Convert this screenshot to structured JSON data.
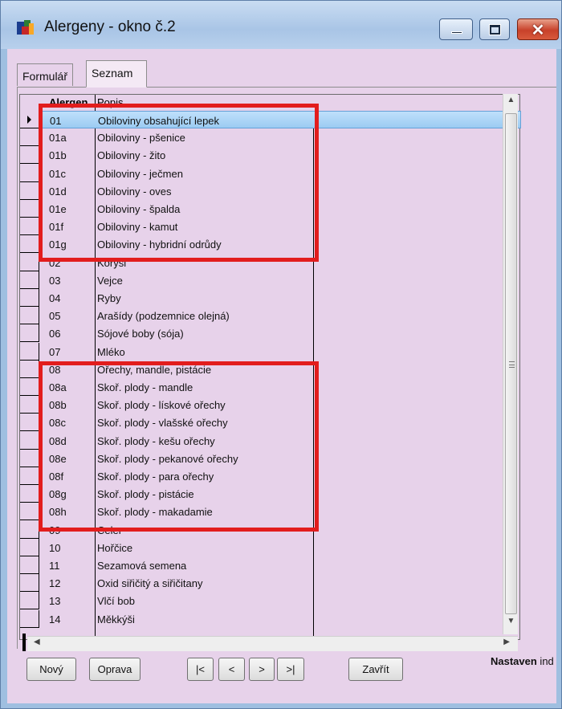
{
  "window": {
    "title": "Alergeny - okno č.2",
    "icon": "app-icon"
  },
  "tabs": [
    {
      "label": "Formulář",
      "active": false
    },
    {
      "label": "Seznam",
      "active": true
    }
  ],
  "grid": {
    "columns": [
      "Alergen",
      "Popis"
    ],
    "rows": [
      {
        "code": "01",
        "desc": "Obiloviny obsahující lepek",
        "selected": true
      },
      {
        "code": "01a",
        "desc": "Obiloviny - pšenice"
      },
      {
        "code": "01b",
        "desc": "Obiloviny - žito"
      },
      {
        "code": "01c",
        "desc": "Obiloviny - ječmen"
      },
      {
        "code": "01d",
        "desc": "Obiloviny - oves"
      },
      {
        "code": "01e",
        "desc": "Obiloviny - špalda"
      },
      {
        "code": "01f",
        "desc": "Obiloviny - kamut"
      },
      {
        "code": "01g",
        "desc": "Obiloviny - hybridní odrůdy"
      },
      {
        "code": "02",
        "desc": "Korýši"
      },
      {
        "code": "03",
        "desc": "Vejce"
      },
      {
        "code": "04",
        "desc": "Ryby"
      },
      {
        "code": "05",
        "desc": "Arašídy (podzemnice olejná)"
      },
      {
        "code": "06",
        "desc": "Sójové boby (sója)"
      },
      {
        "code": "07",
        "desc": "Mléko"
      },
      {
        "code": "08",
        "desc": "Ořechy, mandle, pistácie"
      },
      {
        "code": "08a",
        "desc": "Skoř. plody - mandle"
      },
      {
        "code": "08b",
        "desc": "Skoř. plody - lískové ořechy"
      },
      {
        "code": "08c",
        "desc": "Skoř. plody - vlašské ořechy"
      },
      {
        "code": "08d",
        "desc": "Skoř. plody - kešu ořechy"
      },
      {
        "code": "08e",
        "desc": "Skoř. plody - pekanové ořechy"
      },
      {
        "code": "08f",
        "desc": "Skoř. plody - para ořechy"
      },
      {
        "code": "08g",
        "desc": "Skoř. plody - pistácie"
      },
      {
        "code": "08h",
        "desc": "Skoř. plody - makadamie"
      },
      {
        "code": "09",
        "desc": "Celer"
      },
      {
        "code": "10",
        "desc": "Hořčice"
      },
      {
        "code": "11",
        "desc": "Sezamová semena"
      },
      {
        "code": "12",
        "desc": "Oxid siřičitý a siřičitany"
      },
      {
        "code": "13",
        "desc": "Vlčí bob"
      },
      {
        "code": "14",
        "desc": "Měkkýši"
      }
    ]
  },
  "buttons": {
    "new": "Nový",
    "edit": "Oprava",
    "first": "|<",
    "prev": "<",
    "next": ">",
    "last": ">|",
    "close": "Zavřít"
  },
  "status": {
    "bold": "Nastaven",
    "rest": " ind"
  },
  "colors": {
    "highlight_border": "#e21d1d",
    "selection": "#9ccbf2",
    "background": "#e7d2ea"
  }
}
